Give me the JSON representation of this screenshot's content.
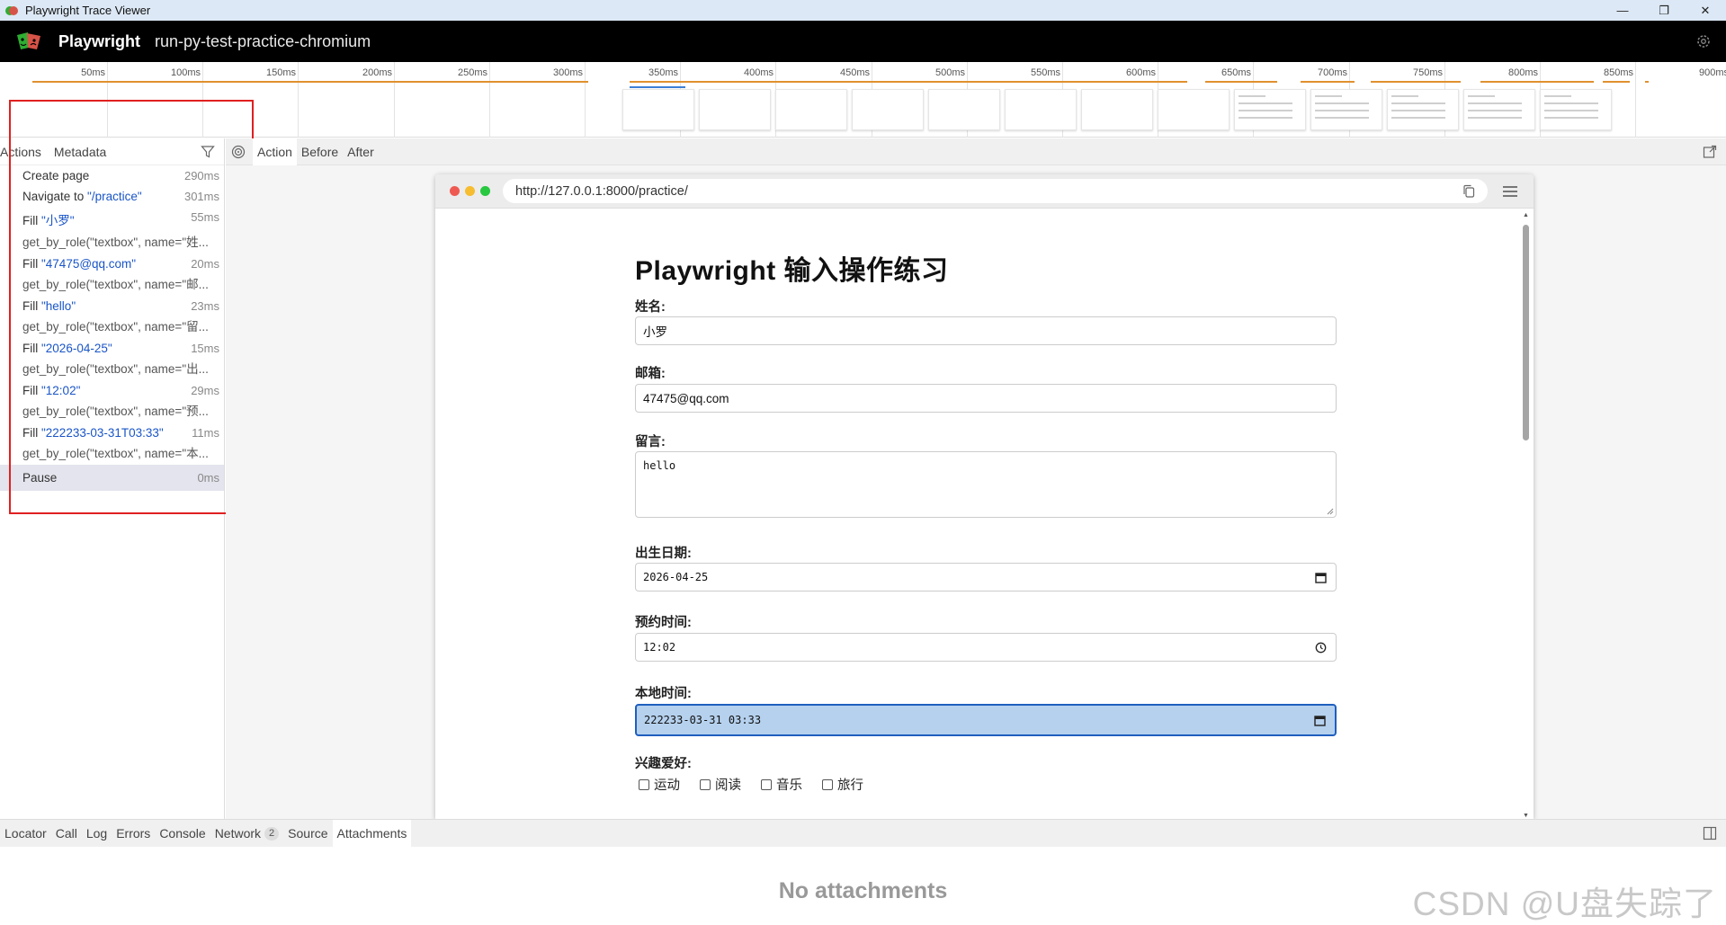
{
  "window": {
    "title": "Playwright Trace Viewer",
    "minimize": "—",
    "restore": "❐",
    "close": "✕"
  },
  "header": {
    "brand": "Playwright",
    "trace_name": "run-py-test-practice-chromium"
  },
  "timeline": {
    "ticks": [
      "50ms",
      "100ms",
      "150ms",
      "200ms",
      "250ms",
      "300ms",
      "350ms",
      "400ms",
      "450ms",
      "500ms",
      "550ms",
      "600ms",
      "650ms",
      "700ms",
      "750ms",
      "800ms",
      "850ms",
      "900ms"
    ]
  },
  "left_pane": {
    "tabs": [
      "Actions",
      "Metadata"
    ],
    "actions": [
      {
        "title": "Create page",
        "value": "",
        "detail": "",
        "duration": "290ms"
      },
      {
        "title": "Navigate to ",
        "value": "\"/practice\"",
        "detail": "",
        "duration": "301ms"
      },
      {
        "title": "Fill ",
        "value": "\"小罗\"",
        "detail": "get_by_role(\"textbox\", name=\"姓...",
        "duration": "55ms"
      },
      {
        "title": "Fill ",
        "value": "\"47475@qq.com\"",
        "detail": "get_by_role(\"textbox\", name=\"邮...",
        "duration": "20ms"
      },
      {
        "title": "Fill ",
        "value": "\"hello\"",
        "detail": "get_by_role(\"textbox\", name=\"留...",
        "duration": "23ms"
      },
      {
        "title": "Fill ",
        "value": "\"2026-04-25\"",
        "detail": "get_by_role(\"textbox\", name=\"出...",
        "duration": "15ms"
      },
      {
        "title": "Fill ",
        "value": "\"12:02\"",
        "detail": "get_by_role(\"textbox\", name=\"预...",
        "duration": "29ms"
      },
      {
        "title": "Fill ",
        "value": "\"222233-03-31T03:33\"",
        "detail": "get_by_role(\"textbox\", name=\"本...",
        "duration": "11ms"
      },
      {
        "title": "Pause",
        "value": "",
        "detail": "",
        "duration": "0ms",
        "selected": true
      }
    ]
  },
  "snapshot_tabs": [
    "Action",
    "Before",
    "After"
  ],
  "browser": {
    "url": "http://127.0.0.1:8000/practice/",
    "page": {
      "heading": "Playwright 输入操作练习",
      "fields": {
        "name_label": "姓名:",
        "name_value": "小罗",
        "email_label": "邮箱:",
        "email_value": "47475@qq.com",
        "message_label": "留言:",
        "message_value": "hello",
        "birth_label": "出生日期:",
        "birth_value": "2026-04-25",
        "time_label": "预约时间:",
        "time_value": "12:02",
        "local_label": "本地时间:",
        "local_value": "222233-03-31 03:33",
        "hobby_label": "兴趣爱好:"
      },
      "hobbies": [
        "运动",
        "阅读",
        "音乐",
        "旅行"
      ]
    }
  },
  "bottom_tabs": [
    "Locator",
    "Call",
    "Log",
    "Errors",
    "Console",
    "Network",
    "Source",
    "Attachments"
  ],
  "network_count": "2",
  "attachments_empty": "No attachments",
  "watermark": "CSDN @U盘失踪了",
  "colors": {
    "header_bg": "#000000",
    "timeline_bar": "#e0912f",
    "highlight_box": "#e02020",
    "link_value": "#1a55c7",
    "focus_border": "#1f5fbf"
  }
}
